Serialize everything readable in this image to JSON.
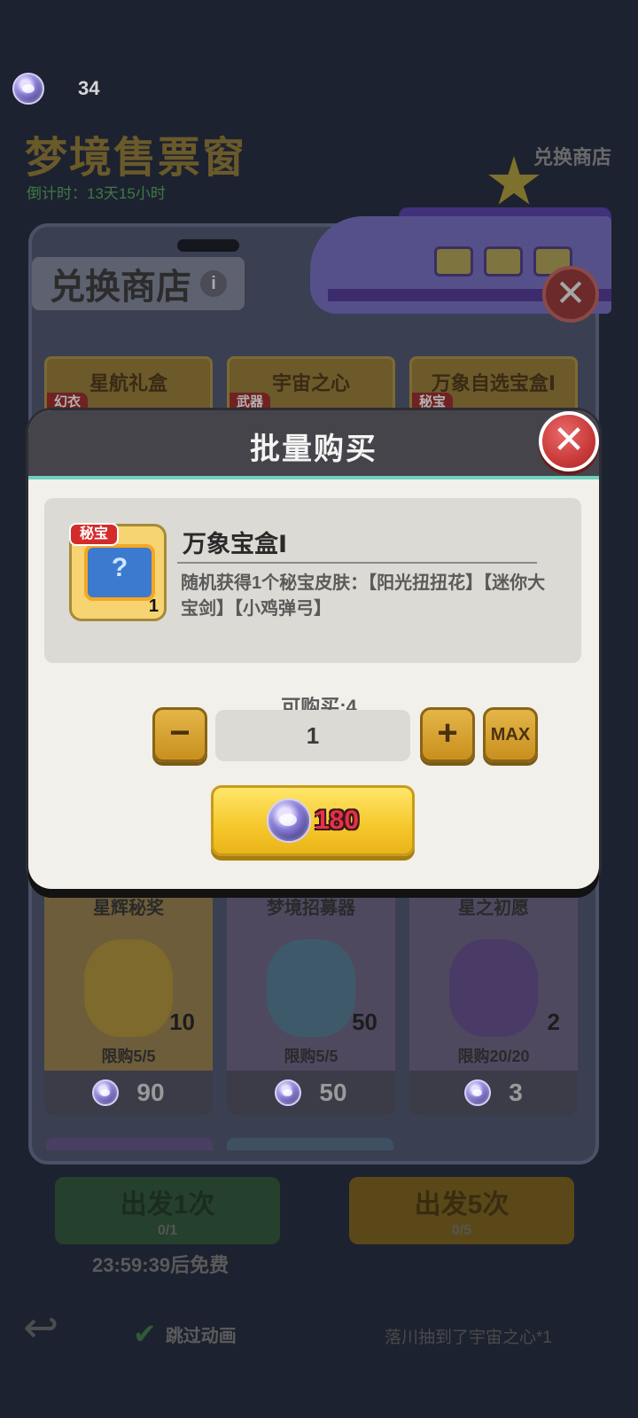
{
  "header": {
    "currency_amount": "34",
    "page_title": "梦境售票窗",
    "countdown": "倒计时：13天15小时",
    "exchange_corner_label": "兑换商店"
  },
  "shop": {
    "title": "兑换商店",
    "info_icon": "info-icon",
    "tabs": [
      {
        "label": "星航礼盒",
        "tag": "幻衣"
      },
      {
        "label": "宇宙之心",
        "tag": "武器"
      },
      {
        "label": "万象自选宝盒Ⅰ",
        "tag": "秘宝"
      }
    ],
    "items": [
      {
        "name": "星辉秘奖",
        "count": "10",
        "limit": "限购5/5",
        "price": "90"
      },
      {
        "name": "梦境招募器",
        "count": "50",
        "limit": "限购5/5",
        "price": "50"
      },
      {
        "name": "星之初愿",
        "count": "2",
        "limit": "限购20/20",
        "price": "3"
      }
    ]
  },
  "gacha": {
    "draw_once": "出发1次",
    "draw_once_sub": "0/1",
    "draw_five": "出发5次",
    "draw_five_sub": "0/5",
    "free_time": "23:59:39后免费",
    "skip_animation": "跳过动画",
    "ticker": "落川抽到了宇宙之心*1"
  },
  "modal": {
    "title": "批量购买",
    "product": {
      "tag": "秘宝",
      "name": "万象宝盒Ⅰ",
      "quantity": "1",
      "description": "随机获得1个秘宝皮肤：【阳光扭扭花】【迷你大宝剑】【小鸡弹弓】"
    },
    "can_buy": "可购买:4",
    "quantity_value": "1",
    "minus_label": "−",
    "plus_label": "+",
    "max_label": "MAX",
    "price": "180"
  },
  "colors": {
    "accent_gold": "#f5c72a",
    "price_red": "#e8304a",
    "close_red": "#c93a3a",
    "modal_bg": "#f2f0ea",
    "modal_header": "#45444a"
  }
}
